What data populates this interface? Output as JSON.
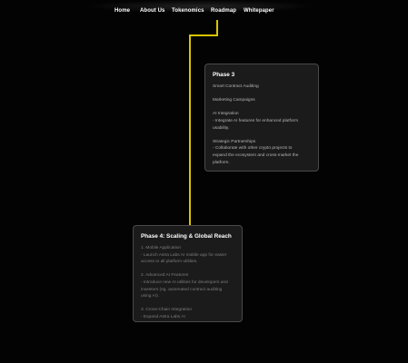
{
  "nav": {
    "items": [
      {
        "label": "Home"
      },
      {
        "label": "About Us"
      },
      {
        "label": "Tokenomics"
      },
      {
        "label": "Roadmap"
      },
      {
        "label": "Whitepaper"
      }
    ]
  },
  "phase3": {
    "title": "Phase 3",
    "lines": [
      "Smart Contract Auditing",
      "",
      "Marketing Campaigns",
      "",
      "AI Integration",
      "- Integrate AI features for enhanced platform",
      "usability.",
      "",
      "Strategic Partnerships",
      "- Collaborate with other crypto projects to",
      "expand the ecosystem and cross-market the",
      "platform."
    ]
  },
  "phase4": {
    "title": "Phase 4: Scaling & Global Reach",
    "lines": [
      "1. Mobile Application",
      "- Launch Astra Labs AI mobile app for easier",
      "access to all platform utilities.",
      "",
      "2. Advanced AI Features",
      "- Introduce new AI utilities for developers and",
      "investors (eg. automated contract auditing",
      "using AI).",
      "",
      "3. Cross-Chain Integration",
      "- Expand Astra Labs AI"
    ]
  },
  "colors": {
    "background": "#030303",
    "accent_line": "#d9c400",
    "card_bg": "#1b1b1b",
    "card_border": "#4a4a4a"
  }
}
